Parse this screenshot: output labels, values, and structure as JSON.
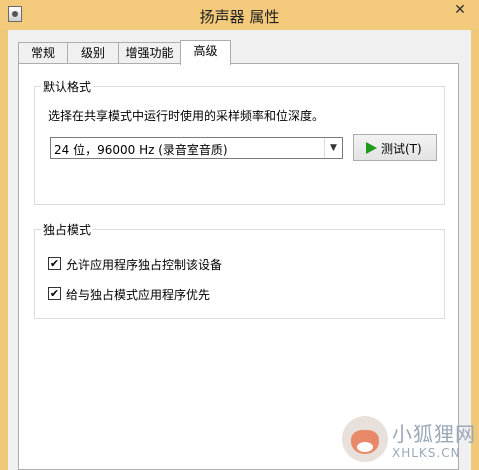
{
  "window": {
    "title": "扬声器 属性",
    "close_glyph": "✕"
  },
  "tabs": [
    {
      "label": "常规",
      "active": false
    },
    {
      "label": "级别",
      "active": false
    },
    {
      "label": "增强功能",
      "active": false
    },
    {
      "label": "高级",
      "active": true
    }
  ],
  "default_format": {
    "group_title": "默认格式",
    "description": "选择在共享模式中运行时使用的采样频率和位深度。",
    "selected_format": "24 位，96000 Hz (录音室音质)",
    "test_button_label": "测试(T)"
  },
  "exclusive_mode": {
    "group_title": "独占模式",
    "options": [
      {
        "label": "允许应用程序独占控制该设备",
        "checked": true
      },
      {
        "label": "给与独占模式应用程序优先",
        "checked": true
      }
    ]
  },
  "watermark": {
    "text_cn": "小狐狸网",
    "text_en": "XHLKS.CN"
  },
  "colors": {
    "titlebar": "#f3c97c",
    "play_icon": "#1f9a1f"
  },
  "icons": {
    "app": "speaker-properties-icon",
    "test": "play-icon",
    "close": "close-icon",
    "dropdown": "chevron-down-icon"
  }
}
